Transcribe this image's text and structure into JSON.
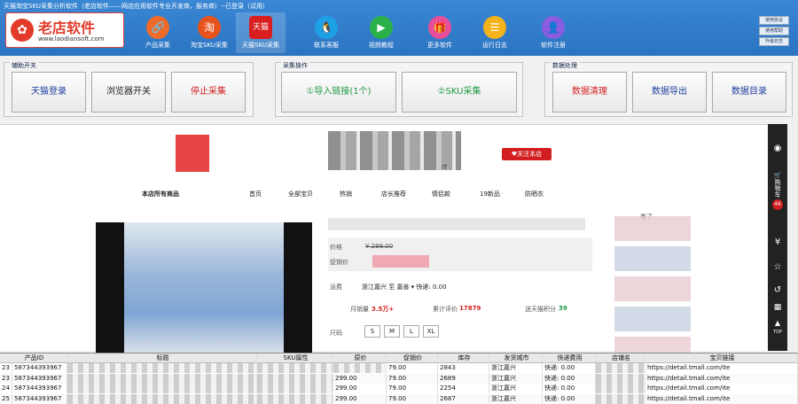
{
  "window": {
    "title": "天猫淘宝SKU采集分析软件（老店软件——网店应用软件专业开发商，服务商）--已登录（试用）"
  },
  "logo": {
    "name": "老店软件",
    "url": "www.laodiansoft.com"
  },
  "nav": [
    {
      "label": "产品采集",
      "icon": "link-icon",
      "color": "#f06a2a"
    },
    {
      "label": "淘宝SKU采集",
      "icon": "taobao-icon",
      "color": "#e8531c"
    },
    {
      "label": "天猫SKU采集",
      "icon": "tmall-icon",
      "color": "#d81e1e"
    },
    {
      "label": "联系客服",
      "icon": "qq-penguin-icon",
      "color": "#1ea0e6"
    },
    {
      "label": "视频教程",
      "icon": "play-icon",
      "color": "#2bb14a"
    },
    {
      "label": "更多软件",
      "icon": "gift-icon",
      "color": "#e64e9a"
    },
    {
      "label": "运行日志",
      "icon": "log-icon",
      "color": "#f4b21b"
    },
    {
      "label": "软件注册",
      "icon": "user-icon",
      "color": "#8a5de0"
    }
  ],
  "nav_active_index": 2,
  "nav_tmall_glyph": "天猫",
  "nav_taobao_glyph": "淘",
  "side_buttons": [
    "使用协议",
    "使用帮助",
    "升级日志"
  ],
  "groups": {
    "assist": {
      "title": "辅助开关",
      "buttons": [
        "天猫登录",
        "浏览器开关",
        "停止采集"
      ]
    },
    "collect": {
      "title": "采集操作",
      "buttons": [
        "①导入链接(1个)",
        "②SKU采集"
      ]
    },
    "data": {
      "title": "数据处理",
      "buttons": [
        "数据清理",
        "数据导出",
        "数据目录"
      ]
    }
  },
  "page": {
    "follow_label": "♥关注本店",
    "shop_fragment": "iT",
    "shop_nav": [
      "本店所有商品",
      "首页",
      "全部宝贝",
      "热销",
      "店长推荐",
      "情侣款",
      "19新品",
      "防晒衣"
    ],
    "price_label": "价格",
    "price_value": "¥ 299.00",
    "promo_label": "促销价",
    "shipping_label": "运费",
    "shipping_value": "浙江嘉兴 至 嘉善 ▾ 快递: 0.00",
    "monthly_label": "月销量",
    "monthly_value": "3.5万+",
    "reviews_label": "累计评价",
    "reviews_value": "17879",
    "points_label": "送天猫积分",
    "points_value": "39",
    "size_label": "尺码",
    "sizes": [
      "S",
      "M",
      "L",
      "XL"
    ],
    "side_label": "看了"
  },
  "toolbar": {
    "cart_label": "购物车",
    "cart_count": "46",
    "top_label": "TOP"
  },
  "grid": {
    "columns": [
      "产品ID",
      "标题",
      "SKU属性",
      "原价",
      "促销价",
      "库存",
      "发货城市",
      "快递费用",
      "店铺名",
      "宝贝链接"
    ],
    "rows": [
      [
        "587344393967",
        "",
        "",
        "",
        "79.00",
        "2843",
        "浙江嘉兴",
        "快递: 0.00",
        "",
        "https://detail.tmall.com/ite"
      ],
      [
        "587344393967",
        "",
        "",
        "299.00",
        "79.00",
        "2689",
        "浙江嘉兴",
        "快递: 0.00",
        "",
        "https://detail.tmall.com/ite"
      ],
      [
        "587344393967",
        "",
        "",
        "299.00",
        "79.00",
        "2254",
        "浙江嘉兴",
        "快递: 0.00",
        "",
        "https://detail.tmall.com/ite"
      ],
      [
        "587344393967",
        "",
        "",
        "299.00",
        "79.00",
        "2687",
        "浙江嘉兴",
        "快递: 0.00",
        "",
        "https://detail.tmall.com/ite"
      ]
    ],
    "row_numbers": [
      "23",
      "23",
      "24",
      "25"
    ]
  }
}
